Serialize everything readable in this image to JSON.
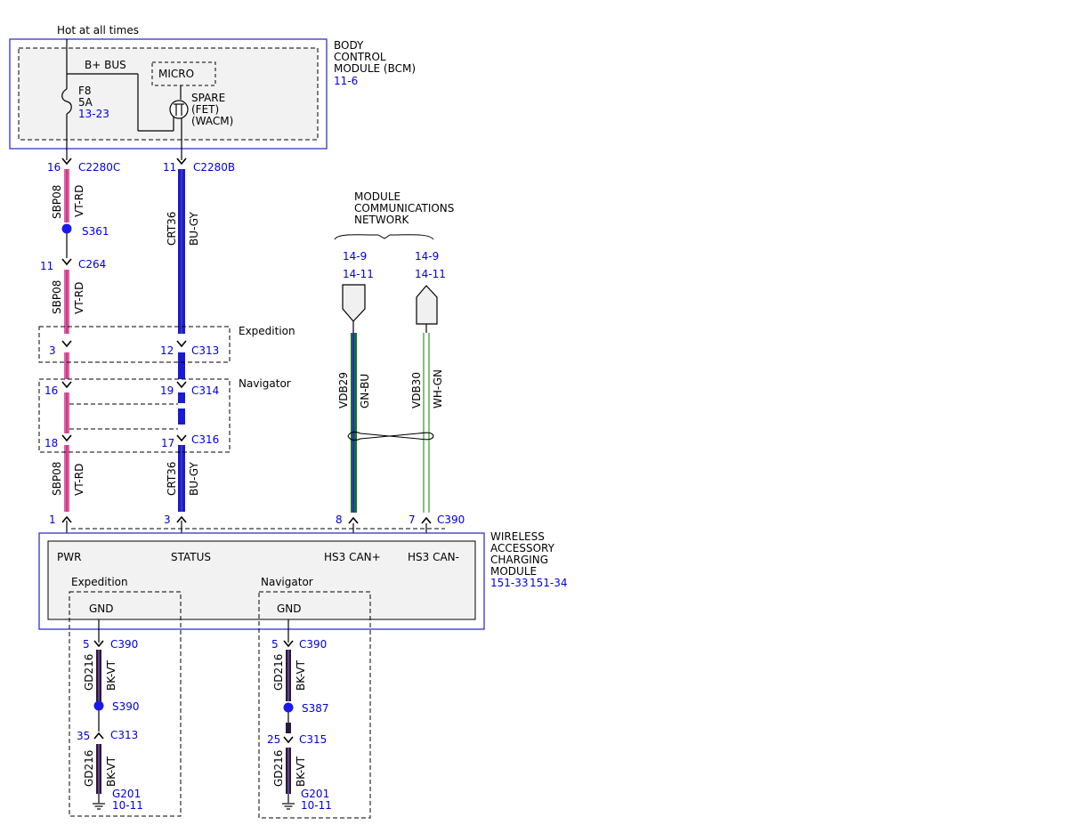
{
  "supply": {
    "label": "Hot at all times"
  },
  "bcm": {
    "name_lines": [
      "BODY",
      "CONTROL",
      "MODULE (BCM)"
    ],
    "ref": "11-6",
    "bus_label": "B+ BUS",
    "micro_label": "MICRO",
    "fuse": {
      "name": "F8",
      "rating": "5A",
      "ref": "13-23"
    },
    "fet_lines": [
      "SPARE",
      "(FET)",
      "(WACM)"
    ]
  },
  "wires": {
    "pwr": {
      "circuit": "SBP08",
      "color": "VT-RD",
      "pins": {
        "bcm": "16",
        "c264": "11",
        "expedition": "3",
        "navigator_in": "16",
        "navigator_out": "18",
        "module": "1"
      }
    },
    "status": {
      "circuit": "CRT36",
      "color": "BU-GY",
      "pins": {
        "bcm": "11",
        "expedition": "12",
        "navigator_in": "19",
        "navigator_out": "17",
        "module": "3"
      }
    },
    "can_hi": {
      "circuit": "VDB29",
      "color": "GN-BU",
      "pin": "8",
      "ref_top": "14-9",
      "ref_bottom": "14-11"
    },
    "can_lo": {
      "circuit": "VDB30",
      "color": "WH-GN",
      "pin": "7",
      "ref_top": "14-9",
      "ref_bottom": "14-11"
    }
  },
  "connectors": {
    "bcm_pwr": "C2280C",
    "bcm_status": "C2280B",
    "c264": "C264",
    "c313": "C313",
    "c314": "C314",
    "c316": "C316",
    "c390": "C390",
    "c315": "C315"
  },
  "splices": {
    "s361": "S361",
    "s390": "S390",
    "s387": "S387"
  },
  "variants": {
    "expedition": "Expedition",
    "navigator": "Navigator"
  },
  "network": {
    "lines": [
      "MODULE",
      "COMMUNICATIONS",
      "NETWORK"
    ]
  },
  "wacm": {
    "name_lines": [
      "WIRELESS",
      "ACCESSORY",
      "CHARGING",
      "MODULE"
    ],
    "refs": [
      "151-33",
      "151-34"
    ],
    "pin_labels": {
      "pwr": "PWR",
      "status": "STATUS",
      "can_hi": "HS3 CAN+",
      "can_lo": "HS3 CAN-"
    },
    "gnd_label": "GND"
  },
  "grounds": {
    "expedition": {
      "circuit": "GD216",
      "color": "BK-VT",
      "pin_c390": "5",
      "pin_c313": "35",
      "ground": "G201",
      "ref": "10-11"
    },
    "navigator": {
      "circuit": "GD216",
      "color": "BK-VT",
      "pin_c390": "5",
      "pin_c315": "25",
      "ground": "G201",
      "ref": "10-11"
    }
  },
  "colors": {
    "violet_red": "#e85aa8",
    "blue_gray": "#1a1ad2",
    "green_blue": "#1b6e2c",
    "white_green": "#3e9e3e",
    "black_violet": "#2a1a3a",
    "module_box": "#3333cc",
    "ref_text": "#0000e0"
  }
}
